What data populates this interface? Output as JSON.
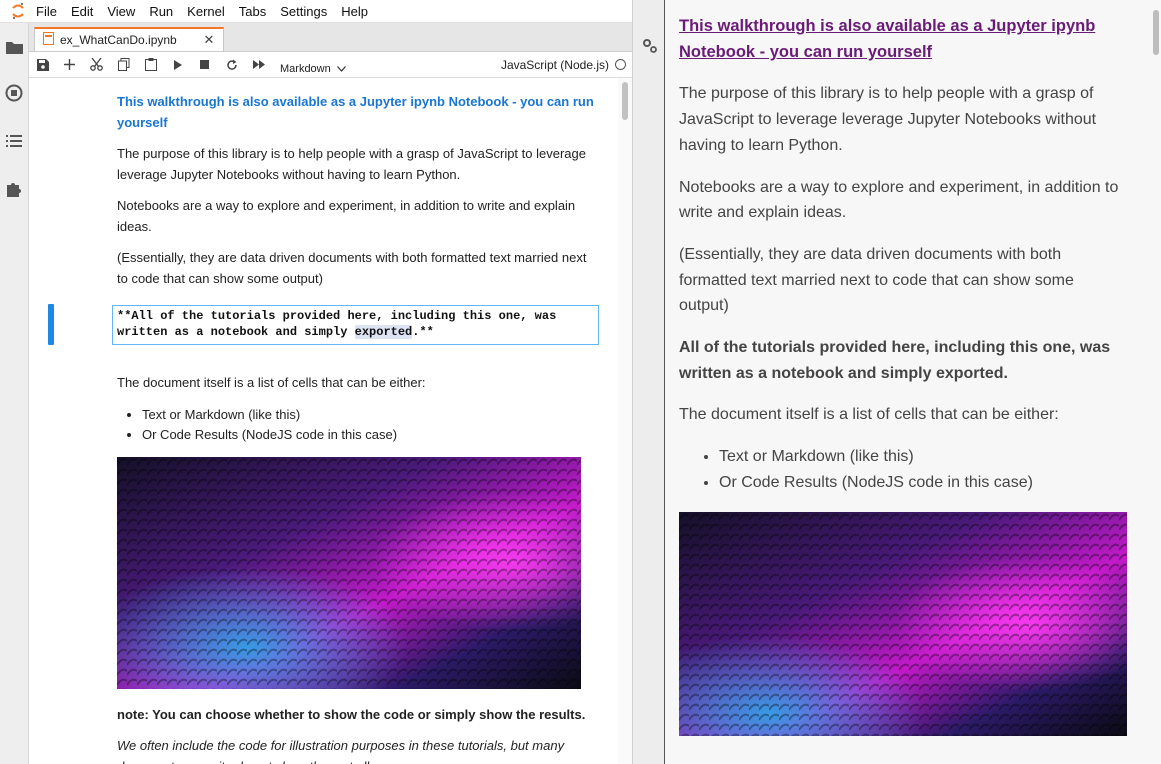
{
  "menu": [
    "File",
    "Edit",
    "View",
    "Run",
    "Kernel",
    "Tabs",
    "Settings",
    "Help"
  ],
  "tab": {
    "label": "ex_WhatCanDo.ipynb",
    "close": "✕"
  },
  "toolbar": {
    "cell_type": "Markdown",
    "kernel": "JavaScript (Node.js)"
  },
  "notebook": {
    "link": "This walkthrough is also available as a Jupyter ipynb Notebook - you can run yourself",
    "p1": "The purpose of this library is to help people with a grasp of JavaScript to leverage leverage Jupyter Notebooks without having to learn Python.",
    "p2": "Notebooks are a way to explore and experiment, in addition to write and explain ideas.",
    "p3": "(Essentially, they are data driven documents with both formatted text married next to code that can show some output)",
    "editor_line1": "**All of the tutorials provided here, including this one, was",
    "editor_line2_pre": "written as a notebook and simply ",
    "editor_line2_hl": "exported",
    "editor_line2_post": ".**",
    "p4": "The document itself is a list of cells that can be either:",
    "bullets": [
      "Text or Markdown (like this)",
      "Or Code Results (NodeJS code in this case)"
    ],
    "note": "note: You can choose whether to show the code or simply show the results.",
    "p5": "We often include the code for illustration purposes in these tutorials, but many documents we write do not show them at all."
  },
  "preview": {
    "link": "This walkthrough is also available as a Jupyter ipynb Notebook - you can run yourself",
    "p1": "The purpose of this library is to help people with a grasp of JavaScript to leverage leverage Jupyter Notebooks without having to learn Python.",
    "p2": "Notebooks are a way to explore and experiment, in addition to write and explain ideas.",
    "p3": "(Essentially, they are data driven documents with both formatted text married next to code that can show some output)",
    "bold": "All of the tutorials provided here, including this one, was written as a notebook and simply exported.",
    "p4": "The document itself is a list of cells that can be either:",
    "bullets": [
      "Text or Markdown (like this)",
      "Or Code Results (NodeJS code in this case)"
    ]
  },
  "colors": {
    "accent": "#1e88e5",
    "link": "#1976d2",
    "preview_link": "#6a1b77",
    "tab_orange": "#f37726"
  }
}
